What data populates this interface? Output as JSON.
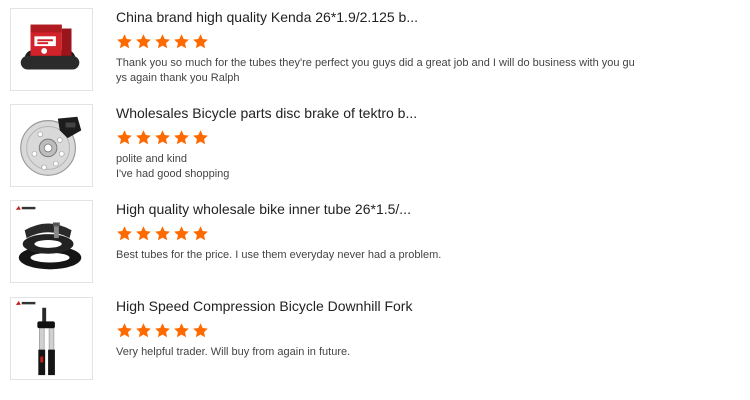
{
  "star_color": "#ff6a00",
  "reviews": [
    {
      "product_title": "China brand high quality Kenda 26*1.9/2.125 b...",
      "rating": 5,
      "comment_lines": [
        "Thank you so much for the tubes they're perfect you guys did a great job and I will do business with you gu",
        "ys again thank you Ralph"
      ],
      "thumbnail_icon": "bike-tube-box-icon"
    },
    {
      "product_title": "Wholesales Bicycle parts disc brake of tektro b...",
      "rating": 5,
      "comment_lines": [
        "polite and kind",
        "I've had good shopping"
      ],
      "thumbnail_icon": "disc-brake-icon"
    },
    {
      "product_title": "High quality wholesale bike inner tube 26*1.5/...",
      "rating": 5,
      "comment_lines": [
        "Best tubes for the price. I use them everyday never had a problem."
      ],
      "thumbnail_icon": "inner-tube-icon"
    },
    {
      "product_title": "High Speed Compression Bicycle Downhill Fork",
      "rating": 5,
      "comment_lines": [
        "Very helpful trader. Will buy from again in future."
      ],
      "thumbnail_icon": "suspension-fork-icon"
    }
  ]
}
